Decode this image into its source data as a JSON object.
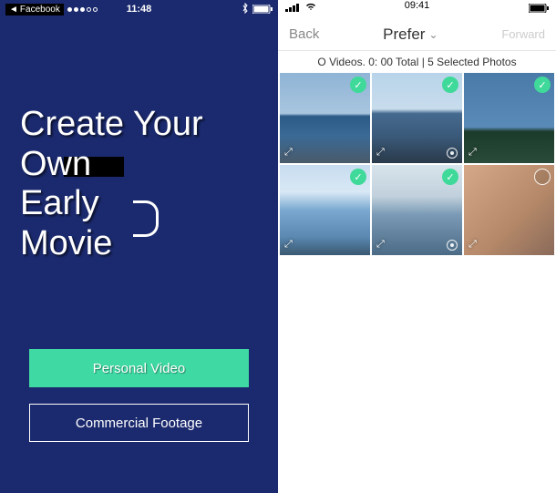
{
  "left": {
    "status": {
      "back_app": "Facebook",
      "time": "11:48"
    },
    "hero": {
      "line1": "Create Your Own",
      "line2": "Early",
      "line3": "Movie"
    },
    "buttons": {
      "primary": "Personal Video",
      "secondary": "Commercial Footage"
    }
  },
  "right": {
    "status": {
      "time": "09:41"
    },
    "nav": {
      "back": "Back",
      "title": "Prefer",
      "forward": "Forward"
    },
    "info_bar": "O Videos. 0: 00 Total | 5 Selected Photos",
    "photos": [
      {
        "selected": true,
        "live": false
      },
      {
        "selected": true,
        "live": true
      },
      {
        "selected": true,
        "live": false
      },
      {
        "selected": true,
        "live": false
      },
      {
        "selected": true,
        "live": true
      },
      {
        "selected": false,
        "live": false
      }
    ]
  }
}
